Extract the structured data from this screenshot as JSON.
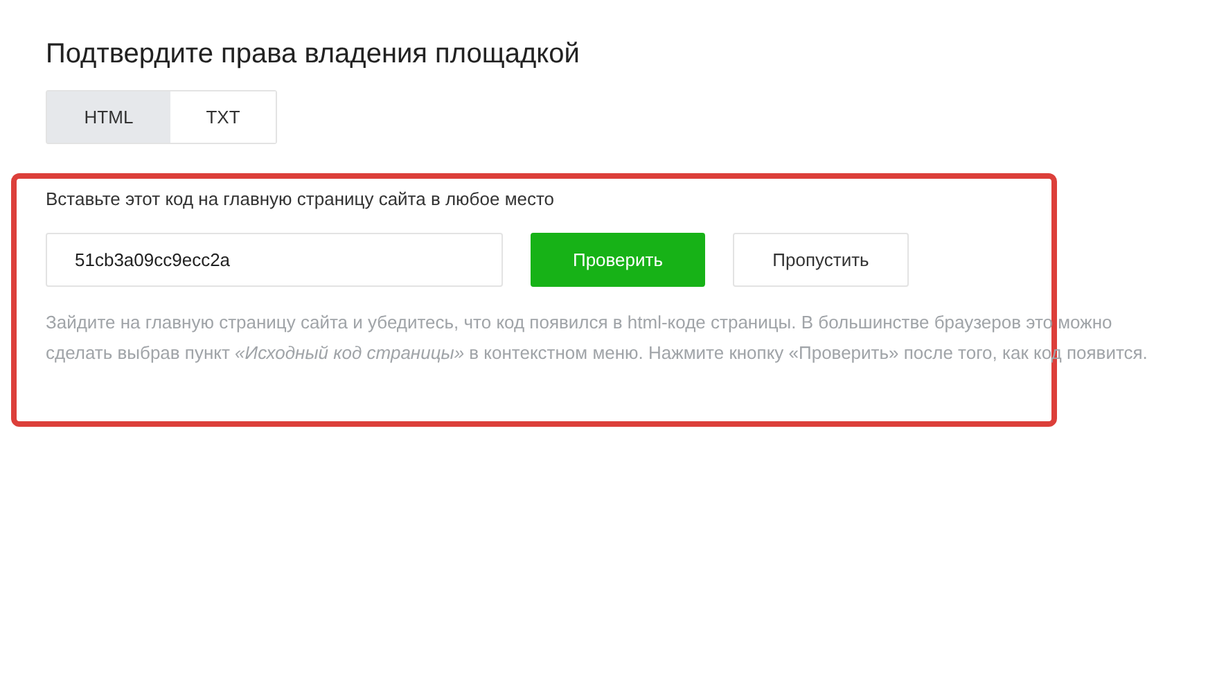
{
  "title": "Подтвердите права владения площадкой",
  "tabs": [
    {
      "label": "HTML",
      "selected": true
    },
    {
      "label": "TXT",
      "selected": false
    }
  ],
  "instruction": "Вставьте этот код на главную страницу сайта в любое место",
  "code_field": {
    "value": "51cb3a09cc9ecc2a"
  },
  "buttons": [
    {
      "label": "Проверить",
      "kind": "primary"
    },
    {
      "label": "Пропустить",
      "kind": "secondary"
    }
  ],
  "hint": "Зайдите на главную страницу сайта и убедитесь, что код появился в html-коде страницы. В большинстве браузеров это можно сделать выбрав пункт *«Исходный код страницы»* в контекстном меню. Нажмите кнопку «Проверить» после того, как код появится."
}
